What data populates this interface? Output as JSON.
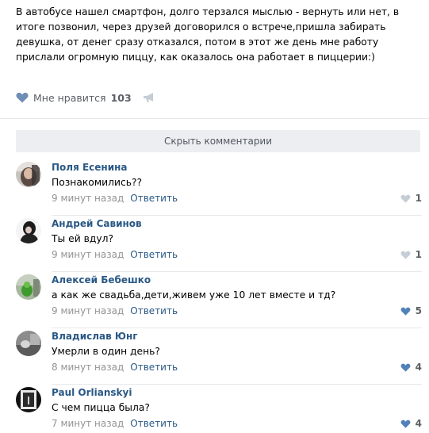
{
  "post": {
    "text": "В автобусе нашел смартфон, долго терзался мыслью - вернуть или нет, в итоге позвонил, через друзей договорился о встрече,пришла забирать девушка, от денег сразу отказался, потом в этот же день мне работу прислали огромную пиццу, как оказалось она работает в пиццерии:)",
    "like_label": "Мне нравится",
    "like_count": "103"
  },
  "comments_toggle": "Скрыть комментарии",
  "colors": {
    "link": "#2a5885",
    "muted": "#939393",
    "like_active": "#5181b8",
    "like_inactive": "#c5cdd6"
  },
  "comments": [
    {
      "author": "Поля Есенина",
      "text": "Познакомились??",
      "time": "9 минут назад",
      "reply": "Ответить",
      "likes": "1",
      "liked": false
    },
    {
      "author": "Андрей Савинов",
      "text": "Ты ей вдул?",
      "time": "9 минут назад",
      "reply": "Ответить",
      "likes": "1",
      "liked": false
    },
    {
      "author": "Алексей Бебешко",
      "text": "а как же свадьба,дети,живем уже 10 лет вместе и тд?",
      "time": "9 минут назад",
      "reply": "Ответить",
      "likes": "5",
      "liked": true
    },
    {
      "author": "Владислав Юнг",
      "text": "Умерли в один день?",
      "time": "8 минут назад",
      "reply": "Ответить",
      "likes": "4",
      "liked": true
    },
    {
      "author": "Paul Orlianskyi",
      "text": "С чем пицца была?",
      "time": "7 минут назад",
      "reply": "Ответить",
      "likes": "4",
      "liked": true
    }
  ]
}
